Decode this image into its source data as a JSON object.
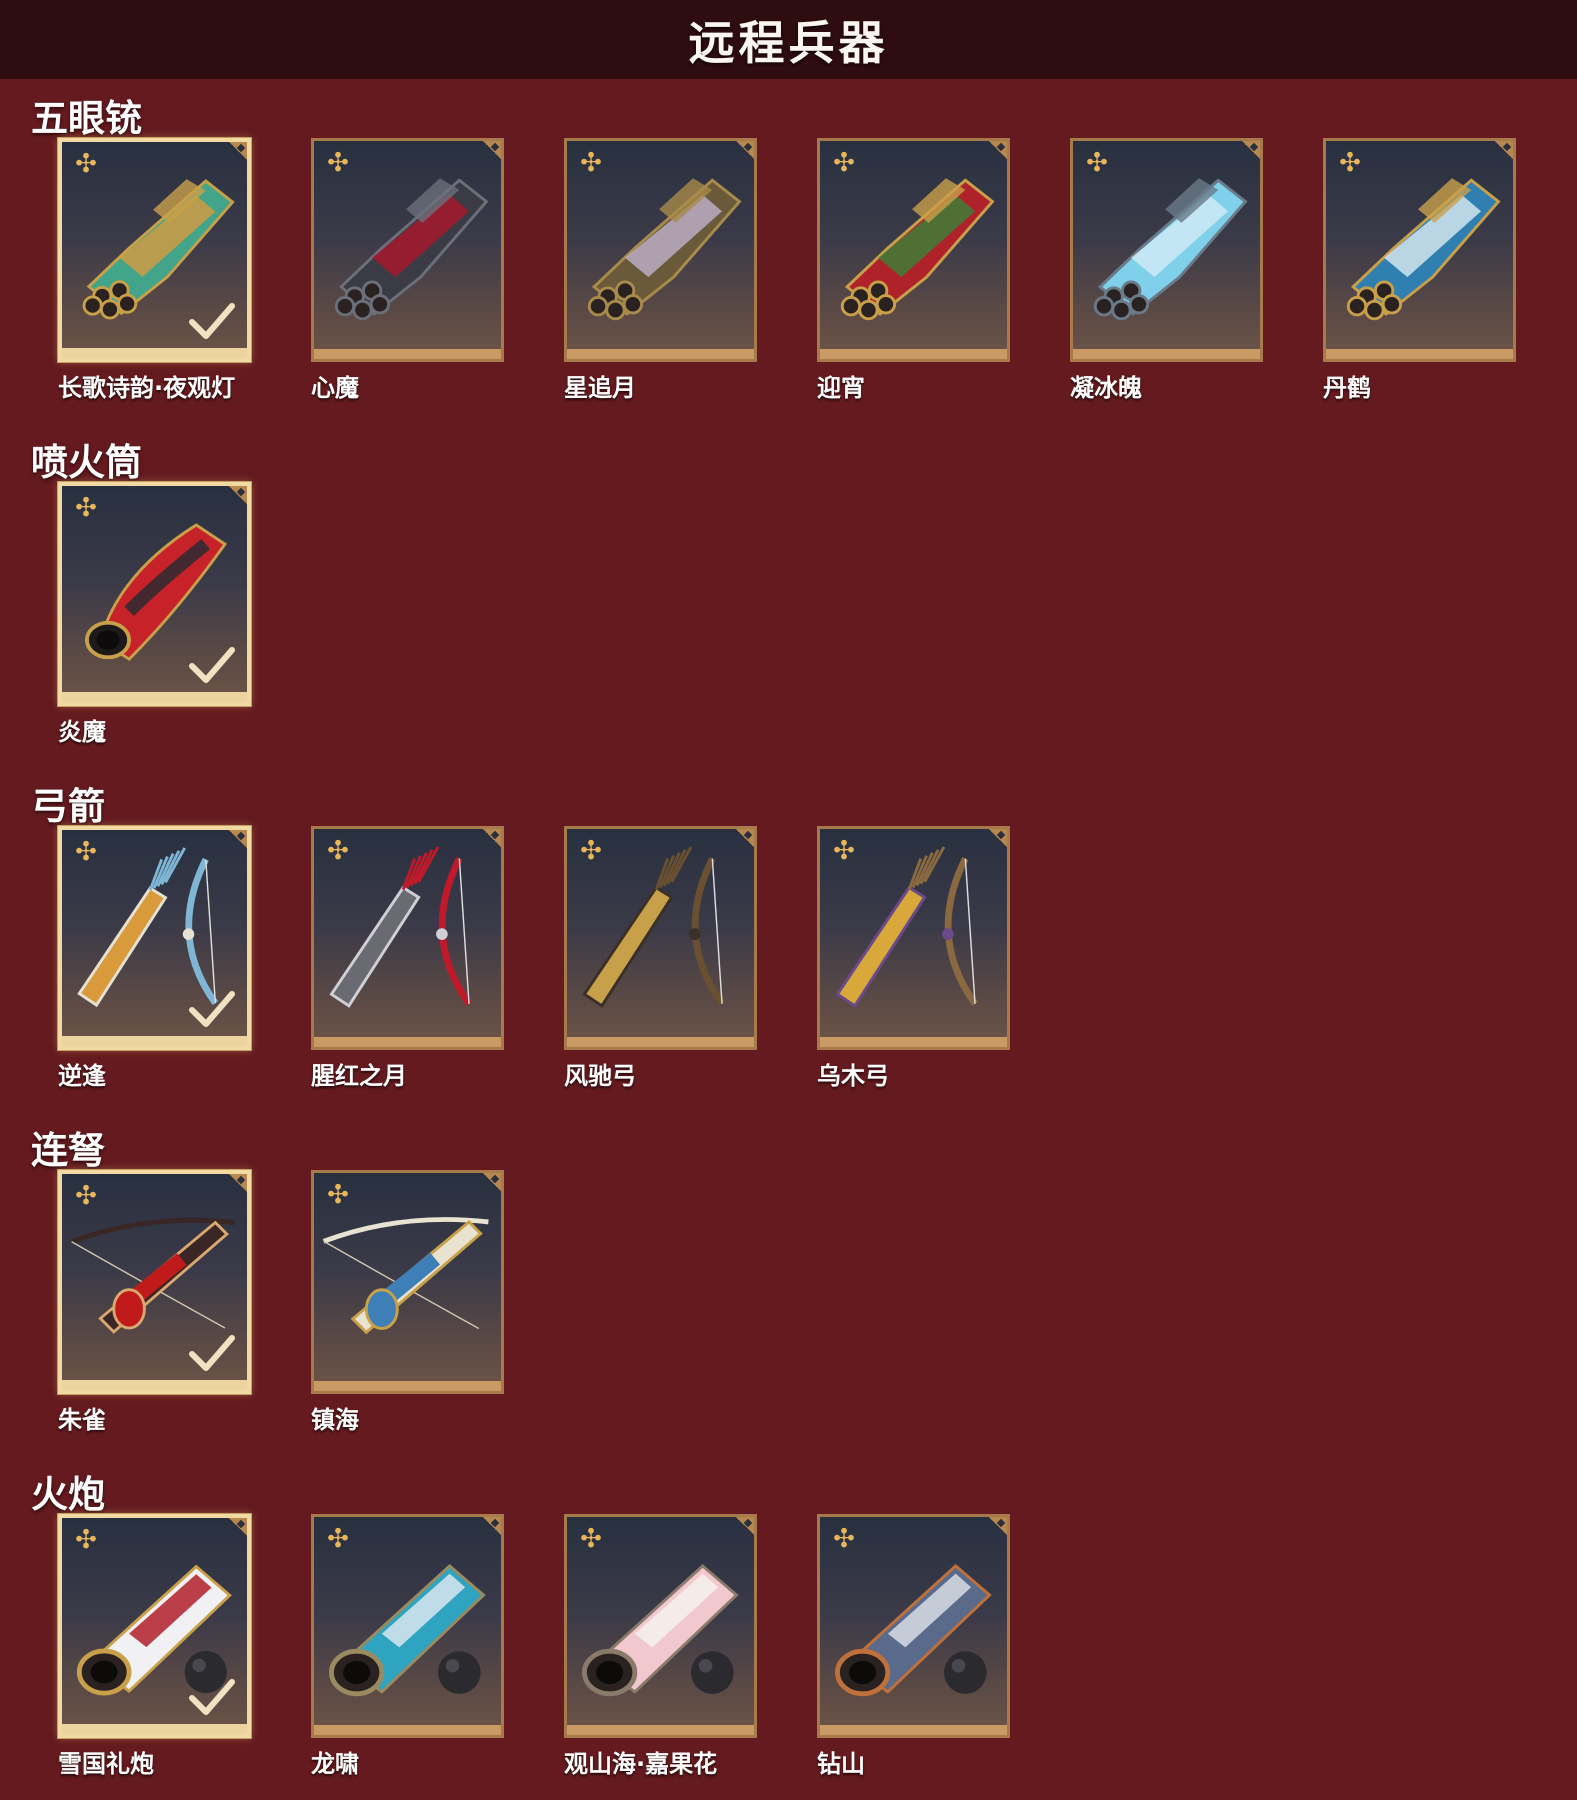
{
  "page_title": "远程兵器",
  "sections": [
    {
      "title": "五眼铳",
      "items": [
        {
          "name": "长歌诗韵·夜观灯",
          "owned": true,
          "icon": "five-barrel-gun-icon",
          "colors": [
            "#42a58a",
            "#e39a3a",
            "#c9a04a"
          ]
        },
        {
          "name": "心魔",
          "owned": false,
          "icon": "five-barrel-gun-icon",
          "colors": [
            "#3b3b45",
            "#b3162a",
            "#6b6f7a"
          ]
        },
        {
          "name": "星追月",
          "owned": false,
          "icon": "five-barrel-gun-icon",
          "colors": [
            "#6a5a3a",
            "#c7b8d8",
            "#a88a4a"
          ]
        },
        {
          "name": "迎宵",
          "owned": false,
          "icon": "five-barrel-gun-icon",
          "colors": [
            "#b0222a",
            "#2f8a3a",
            "#c9a04a"
          ]
        },
        {
          "name": "凝冰魄",
          "owned": false,
          "icon": "five-barrel-gun-icon",
          "colors": [
            "#7fd0ea",
            "#d8eef7",
            "#6a7a88"
          ]
        },
        {
          "name": "丹鹤",
          "owned": false,
          "icon": "five-barrel-gun-icon",
          "colors": [
            "#2f7fb0",
            "#e9f1f5",
            "#c9a04a"
          ]
        }
      ]
    },
    {
      "title": "喷火筒",
      "items": [
        {
          "name": "炎魔",
          "owned": true,
          "icon": "flamethrower-icon",
          "colors": [
            "#c7222a",
            "#2a2a30",
            "#c9a04a"
          ]
        }
      ]
    },
    {
      "title": "弓箭",
      "items": [
        {
          "name": "逆逢",
          "owned": true,
          "icon": "bow-and-quiver-icon",
          "colors": [
            "#7fb6d6",
            "#d89a3a",
            "#e7e1d4"
          ]
        },
        {
          "name": "腥红之月",
          "owned": false,
          "icon": "bow-and-quiver-icon",
          "colors": [
            "#c01a2a",
            "#6a6a72",
            "#cfcfd4"
          ]
        },
        {
          "name": "风驰弓",
          "owned": false,
          "icon": "bow-and-quiver-icon",
          "colors": [
            "#6a5030",
            "#c9a04a",
            "#3a3028"
          ]
        },
        {
          "name": "乌木弓",
          "owned": false,
          "icon": "bow-and-quiver-icon",
          "colors": [
            "#8a6840",
            "#d8a83a",
            "#6a4a8a"
          ]
        }
      ]
    },
    {
      "title": "连弩",
      "items": [
        {
          "name": "朱雀",
          "owned": true,
          "icon": "crossbow-icon",
          "colors": [
            "#c01a1a",
            "#3a2624",
            "#d8a870"
          ]
        },
        {
          "name": "镇海",
          "owned": false,
          "icon": "crossbow-icon",
          "colors": [
            "#3f7fb8",
            "#e8e2d0",
            "#c9a04a"
          ]
        }
      ]
    },
    {
      "title": "火炮",
      "items": [
        {
          "name": "雪国礼炮",
          "owned": true,
          "icon": "cannon-icon",
          "colors": [
            "#f1f1f4",
            "#b0202a",
            "#c9a04a"
          ]
        },
        {
          "name": "龙啸",
          "owned": false,
          "icon": "cannon-icon",
          "colors": [
            "#2fa4c0",
            "#d8e6ee",
            "#9a8a60"
          ]
        },
        {
          "name": "观山海·嘉果花",
          "owned": false,
          "icon": "cannon-icon",
          "colors": [
            "#f2c8cf",
            "#f6f2ee",
            "#8a7a6a"
          ]
        },
        {
          "name": "钻山",
          "owned": false,
          "icon": "cannon-icon",
          "colors": [
            "#5a6a8a",
            "#d8dde4",
            "#c0703a"
          ]
        }
      ]
    }
  ]
}
